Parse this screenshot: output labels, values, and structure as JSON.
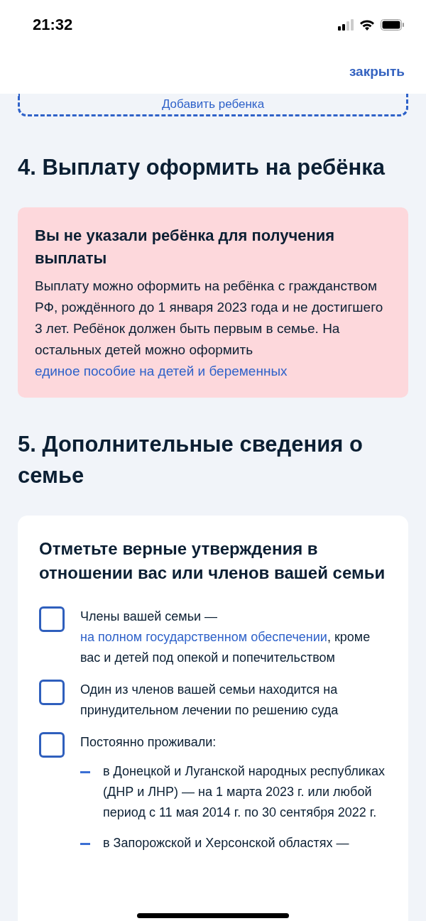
{
  "status_bar": {
    "time": "21:32"
  },
  "header": {
    "close_link": "закрыть"
  },
  "add_child_button": {
    "label": "Добавить ребенка"
  },
  "section_4": {
    "title": "4. Выплату оформить на ребёнка",
    "alert": {
      "title": "Вы не указали ребёнка для получения выплаты",
      "text": "Выплату можно оформить на ребёнка с гражданством РФ, рождённого до 1 января 2023 года и не достигшего 3 лет. Ребёнок должен быть первым в семье. На остальных детей можно оформить ",
      "link": "единое пособие на детей и беременных"
    }
  },
  "section_5": {
    "title": "5. Дополнительные сведения о семье",
    "card": {
      "title": "Отметьте верные утверждения в отношении вас или членов вашей семьи",
      "options": [
        {
          "text_before": "Члены вашей семьи — ",
          "link": "на полном государственном обеспечении",
          "text_after": ", кроме вас и детей под опекой и попечительством",
          "checked": false
        },
        {
          "text_before": "Один из членов вашей семьи находится на принудительном лечении по решению суда",
          "checked": false
        },
        {
          "text_before": "Постоянно проживали:",
          "checked": false,
          "sub_items": [
            "в Донецкой и Луганской народных республиках (ДНР и ЛНР) — на 1 марта 2023 г. или любой период с 11 мая 2014 г. по 30 сентября 2022 г.",
            "в Запорожской и Херсонской областях —"
          ]
        }
      ]
    }
  }
}
